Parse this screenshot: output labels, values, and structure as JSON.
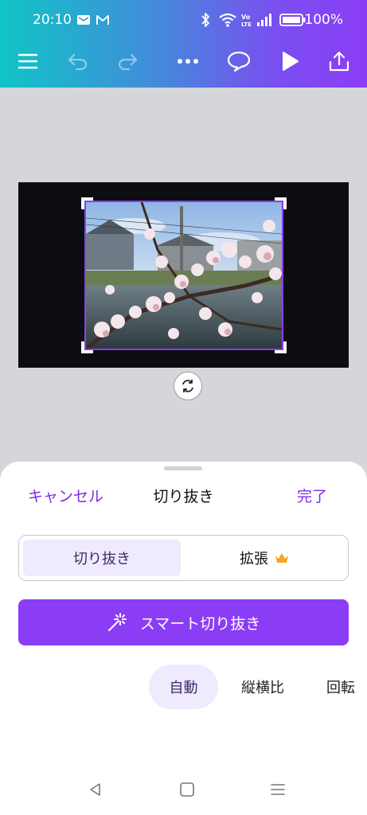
{
  "status_bar": {
    "time": "20:10",
    "battery": "100%",
    "icons": [
      "mail-notification-icon",
      "gmail-icon",
      "bluetooth-icon",
      "wifi-icon",
      "volte-icon",
      "signal-icon",
      "battery-icon"
    ]
  },
  "toolbar": {
    "icons": [
      "menu-icon",
      "undo-icon",
      "redo-icon",
      "more-icon",
      "comment-icon",
      "play-icon",
      "share-icon"
    ]
  },
  "crop_sheet": {
    "cancel_label": "キャンセル",
    "title": "切り抜き",
    "done_label": "完了",
    "segment": {
      "crop_label": "切り抜き",
      "expand_label": "拡張",
      "expand_badge": "crown-icon"
    },
    "smart_crop_label": "スマート切り抜き",
    "tabs": [
      {
        "label": "自動",
        "active": true
      },
      {
        "label": "縦横比",
        "active": false
      },
      {
        "label": "回転",
        "active": false
      }
    ]
  },
  "nav_bar": {
    "icons": [
      "back-icon",
      "home-icon",
      "recents-icon"
    ]
  },
  "colors": {
    "accent": "#8b3df5",
    "accent_text": "#7d2ae8",
    "accent_light": "#efeafd",
    "canvas_background": "#d4d6da",
    "crown": "#f5a623"
  }
}
